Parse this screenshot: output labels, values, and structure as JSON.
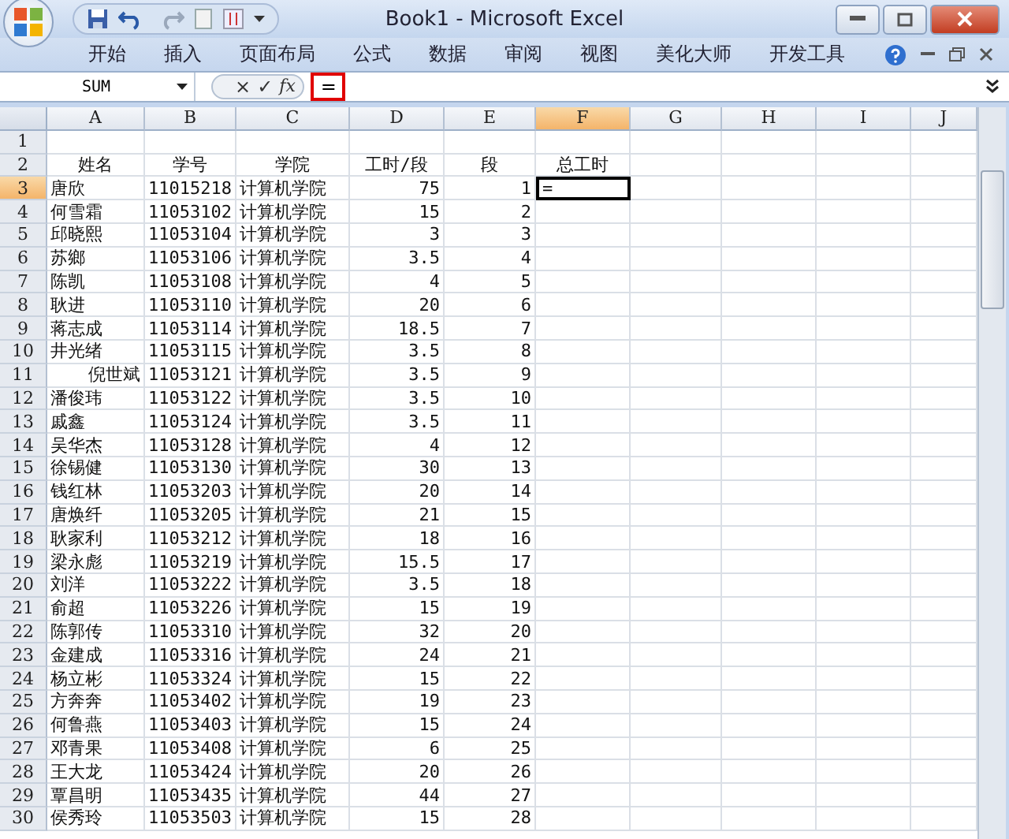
{
  "window": {
    "title": "Book1 - Microsoft Excel"
  },
  "ribbon_tabs": [
    "开始",
    "插入",
    "页面布局",
    "公式",
    "数据",
    "审阅",
    "视图",
    "美化大师",
    "开发工具"
  ],
  "formula_bar": {
    "name_box": "SUM",
    "buttons": [
      "×",
      "✓",
      "fx"
    ],
    "formula": "=",
    "highlighted": true
  },
  "columns": [
    {
      "label": "A",
      "selected": false
    },
    {
      "label": "B",
      "selected": false
    },
    {
      "label": "C",
      "selected": false
    },
    {
      "label": "D",
      "selected": false
    },
    {
      "label": "E",
      "selected": false
    },
    {
      "label": "F",
      "selected": true
    },
    {
      "label": "G",
      "selected": false
    },
    {
      "label": "H",
      "selected": false
    },
    {
      "label": "I",
      "selected": false
    },
    {
      "label": "J",
      "selected": false
    }
  ],
  "rows": [
    {
      "number": "1",
      "selected": false,
      "name_right": false,
      "cells": []
    },
    {
      "number": "2",
      "selected": false,
      "name_right": false,
      "cells": [
        "姓名",
        "学号",
        "学院",
        "工时/段",
        "段",
        "总工时"
      ]
    },
    {
      "number": "3",
      "selected": true,
      "name_right": false,
      "cells": [
        "唐欣",
        "11015218",
        "计算机学院",
        "75",
        "1",
        "="
      ]
    },
    {
      "number": "4",
      "selected": false,
      "name_right": false,
      "cells": [
        "何雪霜",
        "11053102",
        "计算机学院",
        "15",
        "2"
      ]
    },
    {
      "number": "5",
      "selected": false,
      "name_right": false,
      "cells": [
        "邱晓熙",
        "11053104",
        "计算机学院",
        "3",
        "3"
      ]
    },
    {
      "number": "6",
      "selected": false,
      "name_right": false,
      "cells": [
        "苏鄉",
        "11053106",
        "计算机学院",
        "3.5",
        "4"
      ]
    },
    {
      "number": "7",
      "selected": false,
      "name_right": false,
      "cells": [
        "陈凯",
        "11053108",
        "计算机学院",
        "4",
        "5"
      ]
    },
    {
      "number": "8",
      "selected": false,
      "name_right": false,
      "cells": [
        "耿进",
        "11053110",
        "计算机学院",
        "20",
        "6"
      ]
    },
    {
      "number": "9",
      "selected": false,
      "name_right": false,
      "cells": [
        "蒋志成",
        "11053114",
        "计算机学院",
        "18.5",
        "7"
      ]
    },
    {
      "number": "10",
      "selected": false,
      "name_right": false,
      "cells": [
        "井光绪",
        "11053115",
        "计算机学院",
        "3.5",
        "8"
      ]
    },
    {
      "number": "11",
      "selected": false,
      "name_right": true,
      "cells": [
        "倪世斌",
        "11053121",
        "计算机学院",
        "3.5",
        "9"
      ]
    },
    {
      "number": "12",
      "selected": false,
      "name_right": false,
      "cells": [
        "潘俊玮",
        "11053122",
        "计算机学院",
        "3.5",
        "10"
      ]
    },
    {
      "number": "13",
      "selected": false,
      "name_right": false,
      "cells": [
        "戚鑫",
        "11053124",
        "计算机学院",
        "3.5",
        "11"
      ]
    },
    {
      "number": "14",
      "selected": false,
      "name_right": false,
      "cells": [
        "吴华杰",
        "11053128",
        "计算机学院",
        "4",
        "12"
      ]
    },
    {
      "number": "15",
      "selected": false,
      "name_right": false,
      "cells": [
        "徐锡健",
        "11053130",
        "计算机学院",
        "30",
        "13"
      ]
    },
    {
      "number": "16",
      "selected": false,
      "name_right": false,
      "cells": [
        "钱红林",
        "11053203",
        "计算机学院",
        "20",
        "14"
      ]
    },
    {
      "number": "17",
      "selected": false,
      "name_right": false,
      "cells": [
        "唐焕纤",
        "11053205",
        "计算机学院",
        "21",
        "15"
      ]
    },
    {
      "number": "18",
      "selected": false,
      "name_right": false,
      "cells": [
        "耿家利",
        "11053212",
        "计算机学院",
        "18",
        "16"
      ]
    },
    {
      "number": "19",
      "selected": false,
      "name_right": false,
      "cells": [
        "梁永彪",
        "11053219",
        "计算机学院",
        "15.5",
        "17"
      ]
    },
    {
      "number": "20",
      "selected": false,
      "name_right": false,
      "cells": [
        "刘洋",
        "11053222",
        "计算机学院",
        "3.5",
        "18"
      ]
    },
    {
      "number": "21",
      "selected": false,
      "name_right": false,
      "cells": [
        "俞超",
        "11053226",
        "计算机学院",
        "15",
        "19"
      ]
    },
    {
      "number": "22",
      "selected": false,
      "name_right": false,
      "cells": [
        "陈郭传",
        "11053310",
        "计算机学院",
        "32",
        "20"
      ]
    },
    {
      "number": "23",
      "selected": false,
      "name_right": false,
      "cells": [
        "金建成",
        "11053316",
        "计算机学院",
        "24",
        "21"
      ]
    },
    {
      "number": "24",
      "selected": false,
      "name_right": false,
      "cells": [
        "杨立彬",
        "11053324",
        "计算机学院",
        "15",
        "22"
      ]
    },
    {
      "number": "25",
      "selected": false,
      "name_right": false,
      "cells": [
        "方奔奔",
        "11053402",
        "计算机学院",
        "19",
        "23"
      ]
    },
    {
      "number": "26",
      "selected": false,
      "name_right": false,
      "cells": [
        "何鲁燕",
        "11053403",
        "计算机学院",
        "15",
        "24"
      ]
    },
    {
      "number": "27",
      "selected": false,
      "name_right": false,
      "cells": [
        "邓青果",
        "11053408",
        "计算机学院",
        "6",
        "25"
      ]
    },
    {
      "number": "28",
      "selected": false,
      "name_right": false,
      "cells": [
        "王大龙",
        "11053424",
        "计算机学院",
        "20",
        "26"
      ]
    },
    {
      "number": "29",
      "selected": false,
      "name_right": false,
      "cells": [
        "覃昌明",
        "11053435",
        "计算机学院",
        "44",
        "27"
      ]
    },
    {
      "number": "30",
      "selected": false,
      "name_right": false,
      "cells": [
        "侯秀玲",
        "11053503",
        "计算机学院",
        "15",
        "28"
      ]
    }
  ]
}
